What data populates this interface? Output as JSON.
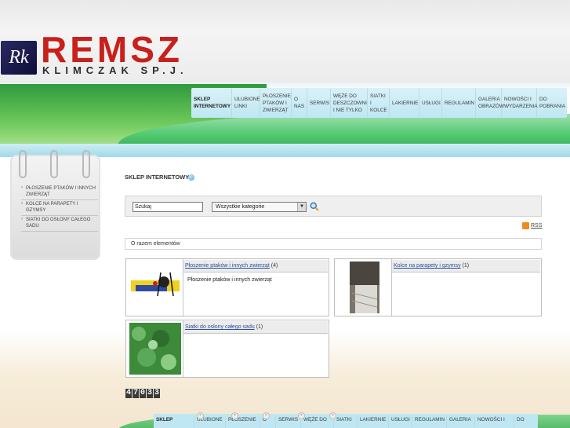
{
  "logo": {
    "badge": "Rk",
    "name": "REMSZ",
    "subtitle": "KLIMCZAK SP.J."
  },
  "nav": [
    {
      "label": "SKLEP INTERNETOWY",
      "active": true
    },
    {
      "label": "ULUBIONE LINKI"
    },
    {
      "label": "PŁOSZENIE PTAKÓW I ZWIERZĄT"
    },
    {
      "label": "O NAS"
    },
    {
      "label": "SERWIS"
    },
    {
      "label": "WĘŻE DO DESZCZOWNI I NIE TYLKO"
    },
    {
      "label": "SIATKI I KOLCE"
    },
    {
      "label": "LAKIERNIE"
    },
    {
      "label": "USŁUGI"
    },
    {
      "label": "REGULAMIN"
    },
    {
      "label": "GALERIA OBRAZÓW"
    },
    {
      "label": "NOWOŚCI I WYDARZENIA"
    },
    {
      "label": "DO POBRANIA"
    }
  ],
  "sidebar": {
    "categories": [
      "PŁOSZENIE PTAKÓW I INNYCH ZWIERZĄT",
      "KOLCE NA PARAPETY I GZYMSY",
      "SIATKI DO OSŁONY CAŁEGO SADU"
    ]
  },
  "main": {
    "title": "SKLEP INTERNETOWY",
    "search": {
      "value": "Szukaj",
      "category": "Wszystkie kategorie"
    },
    "rss": "RSS",
    "count_text": "O razem elementów",
    "cards": [
      {
        "title": "Płoszenie ptaków i innych zwierząt",
        "count": "(4)",
        "desc": "Płoszenie ptaków i innych zwierząt"
      },
      {
        "title": "Kolce na parapety i gzymsy",
        "count": "(1)",
        "desc": ""
      },
      {
        "title": "Siatki do osłony całego sadu",
        "count": "(1)",
        "desc": ""
      }
    ],
    "counter": [
      "4",
      "7",
      "0",
      "3",
      "3"
    ]
  },
  "bottomnav": [
    {
      "label": "SKLEP"
    },
    {
      "label": "ULUBIONE"
    },
    {
      "label": "PŁOSZENIE"
    },
    {
      "label": "O"
    },
    {
      "label": "SERWIS"
    },
    {
      "label": "WĘŻE DO"
    },
    {
      "label": "SIATKI"
    },
    {
      "label": "LAKIERNIE"
    },
    {
      "label": "USŁUGI"
    },
    {
      "label": "REGULAMIN"
    },
    {
      "label": "GALERIA"
    },
    {
      "label": "NOWOŚCI I"
    },
    {
      "label": "DO"
    }
  ],
  "colors": {
    "brand_red": "#c8201a",
    "brand_navy": "#1b1b4a",
    "green": "#3aa84e",
    "link": "#2a4f9a"
  }
}
